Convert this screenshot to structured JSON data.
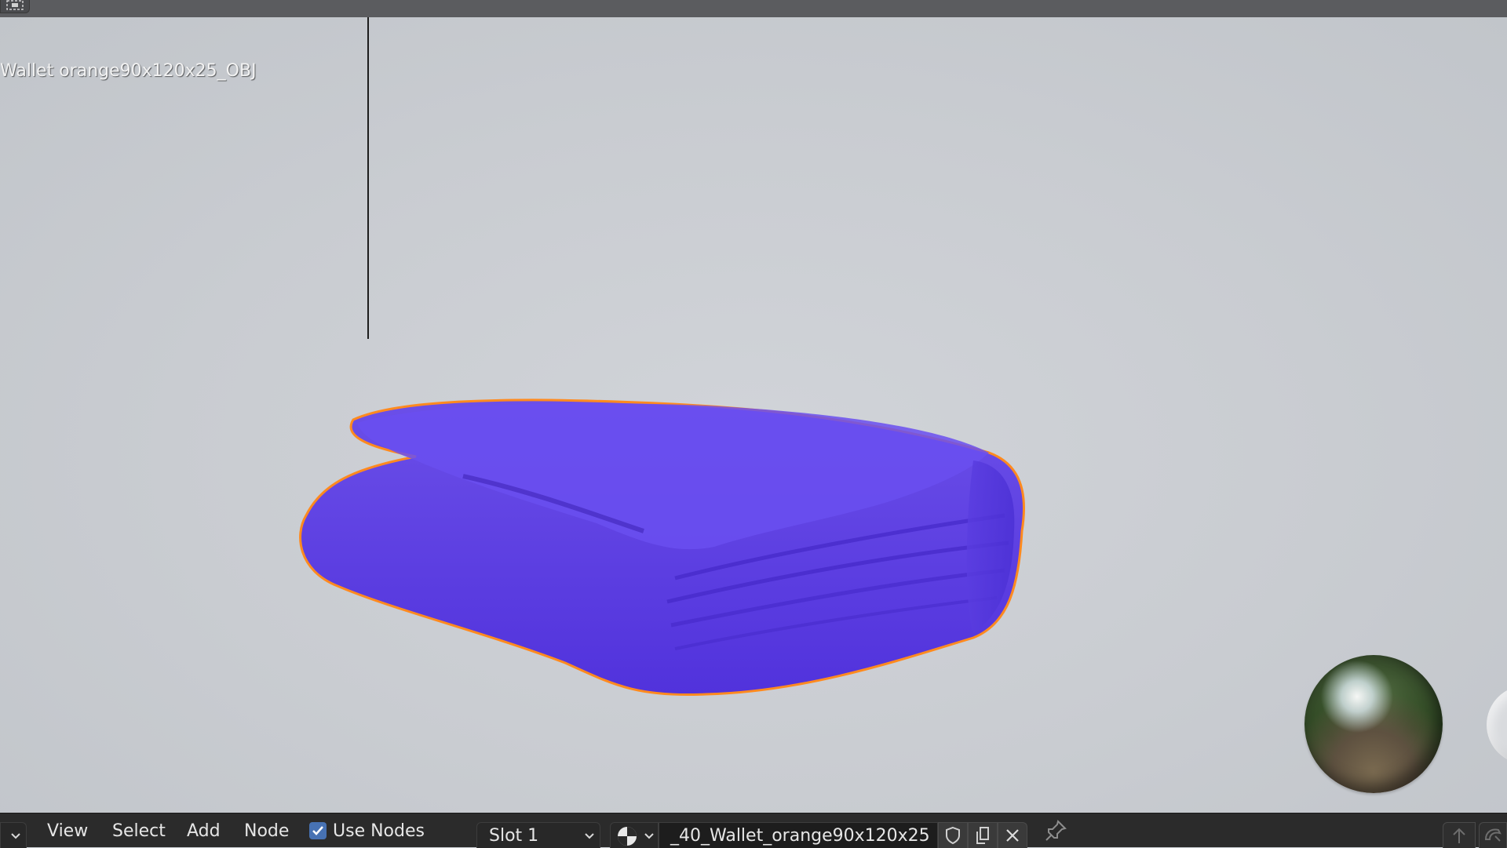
{
  "window": {
    "topbar_icon": "editor-type-icon"
  },
  "viewport": {
    "object_label": "Wallet orange90x120x25_OBJ",
    "object_color": "#6347e4",
    "selection_outline_color": "#ff8a1f",
    "background_color": "#c9ccd1"
  },
  "header": {
    "menus": [
      "View",
      "Select",
      "Add",
      "Node"
    ],
    "use_nodes": {
      "label": "Use Nodes",
      "checked": true
    },
    "slot": {
      "selected": "Slot 1"
    },
    "material": {
      "name": "_40_Wallet_orange90x120x25"
    },
    "icons": [
      "material-ball-icon",
      "fake-user-shield-icon",
      "new-material-icon",
      "unlink-x-icon",
      "pin-icon",
      "parent-arrow-icon",
      "snap-icon"
    ],
    "accent_color": "#4772b3"
  }
}
